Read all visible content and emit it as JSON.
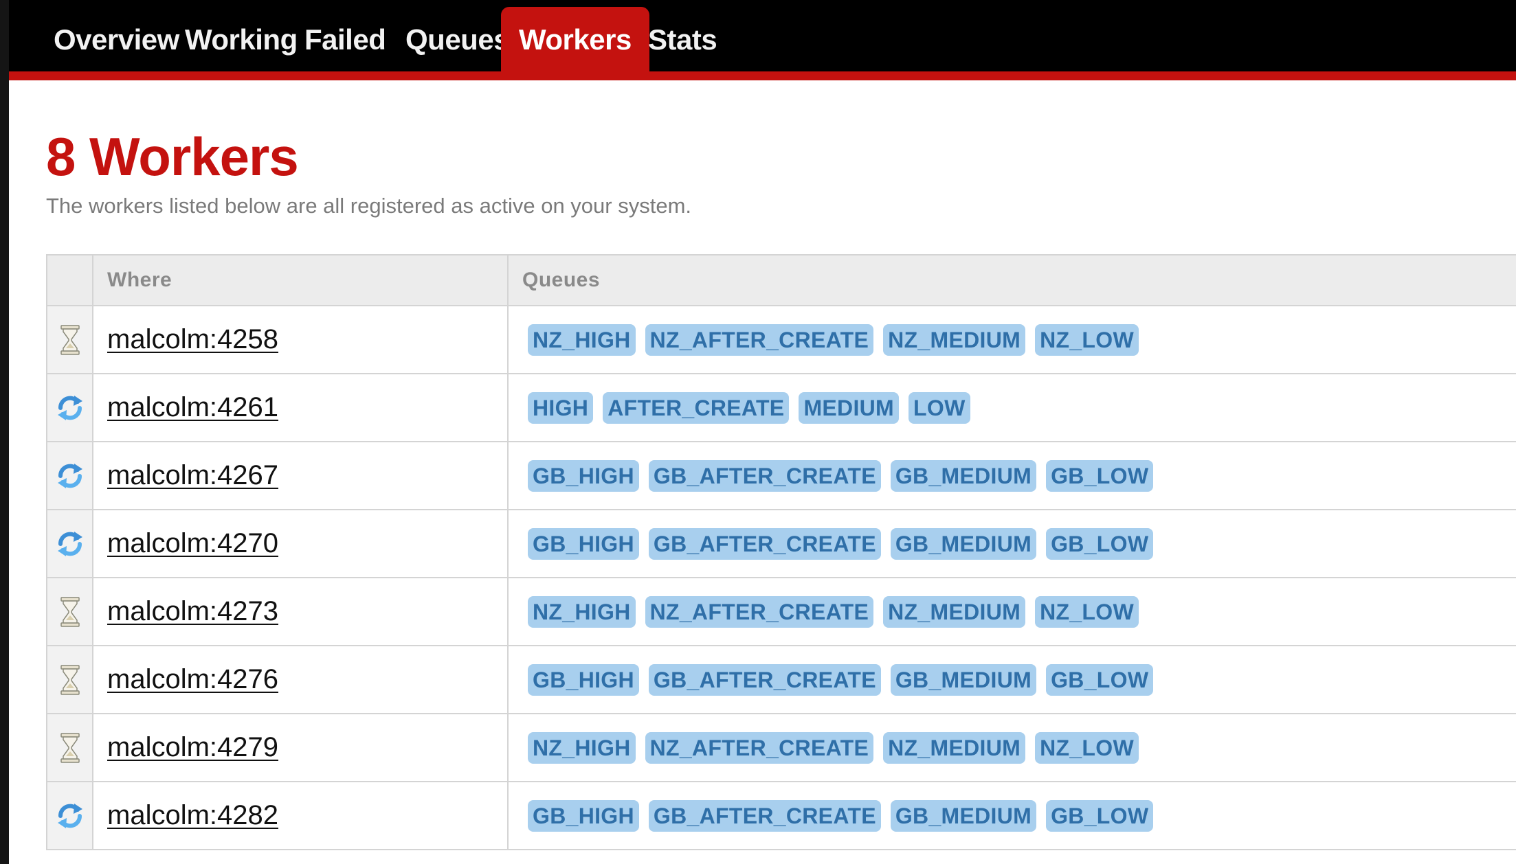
{
  "nav": {
    "tabs": [
      {
        "label": "Overview",
        "active": false
      },
      {
        "label": "Working",
        "active": false
      },
      {
        "label": "Failed",
        "active": false
      },
      {
        "label": "Queues",
        "active": false
      },
      {
        "label": "Workers",
        "active": true
      },
      {
        "label": "Stats",
        "active": false
      }
    ]
  },
  "page": {
    "title": "8 Workers",
    "subtitle": "The workers listed below are all registered as active on your system."
  },
  "table": {
    "columns": [
      "",
      "Where",
      "Queues"
    ],
    "rows": [
      {
        "state": "idle",
        "state_icon": "hourglass-icon",
        "where": "malcolm:4258",
        "queues": [
          "NZ_HIGH",
          "NZ_AFTER_CREATE",
          "NZ_MEDIUM",
          "NZ_LOW"
        ]
      },
      {
        "state": "working",
        "state_icon": "refresh-icon",
        "where": "malcolm:4261",
        "queues": [
          "HIGH",
          "AFTER_CREATE",
          "MEDIUM",
          "LOW"
        ]
      },
      {
        "state": "working",
        "state_icon": "refresh-icon",
        "where": "malcolm:4267",
        "queues": [
          "GB_HIGH",
          "GB_AFTER_CREATE",
          "GB_MEDIUM",
          "GB_LOW"
        ]
      },
      {
        "state": "working",
        "state_icon": "refresh-icon",
        "where": "malcolm:4270",
        "queues": [
          "GB_HIGH",
          "GB_AFTER_CREATE",
          "GB_MEDIUM",
          "GB_LOW"
        ]
      },
      {
        "state": "idle",
        "state_icon": "hourglass-icon",
        "where": "malcolm:4273",
        "queues": [
          "NZ_HIGH",
          "NZ_AFTER_CREATE",
          "NZ_MEDIUM",
          "NZ_LOW"
        ]
      },
      {
        "state": "idle",
        "state_icon": "hourglass-icon",
        "where": "malcolm:4276",
        "queues": [
          "GB_HIGH",
          "GB_AFTER_CREATE",
          "GB_MEDIUM",
          "GB_LOW"
        ]
      },
      {
        "state": "idle",
        "state_icon": "hourglass-icon",
        "where": "malcolm:4279",
        "queues": [
          "NZ_HIGH",
          "NZ_AFTER_CREATE",
          "NZ_MEDIUM",
          "NZ_LOW"
        ]
      },
      {
        "state": "working",
        "state_icon": "refresh-icon",
        "where": "malcolm:4282",
        "queues": [
          "GB_HIGH",
          "GB_AFTER_CREATE",
          "GB_MEDIUM",
          "GB_LOW"
        ]
      }
    ]
  },
  "colors": {
    "accent": "#c4120f",
    "nav_bg": "#000000",
    "queue_tag_bg": "#a8cfee",
    "queue_tag_text": "#2f6fa8"
  }
}
